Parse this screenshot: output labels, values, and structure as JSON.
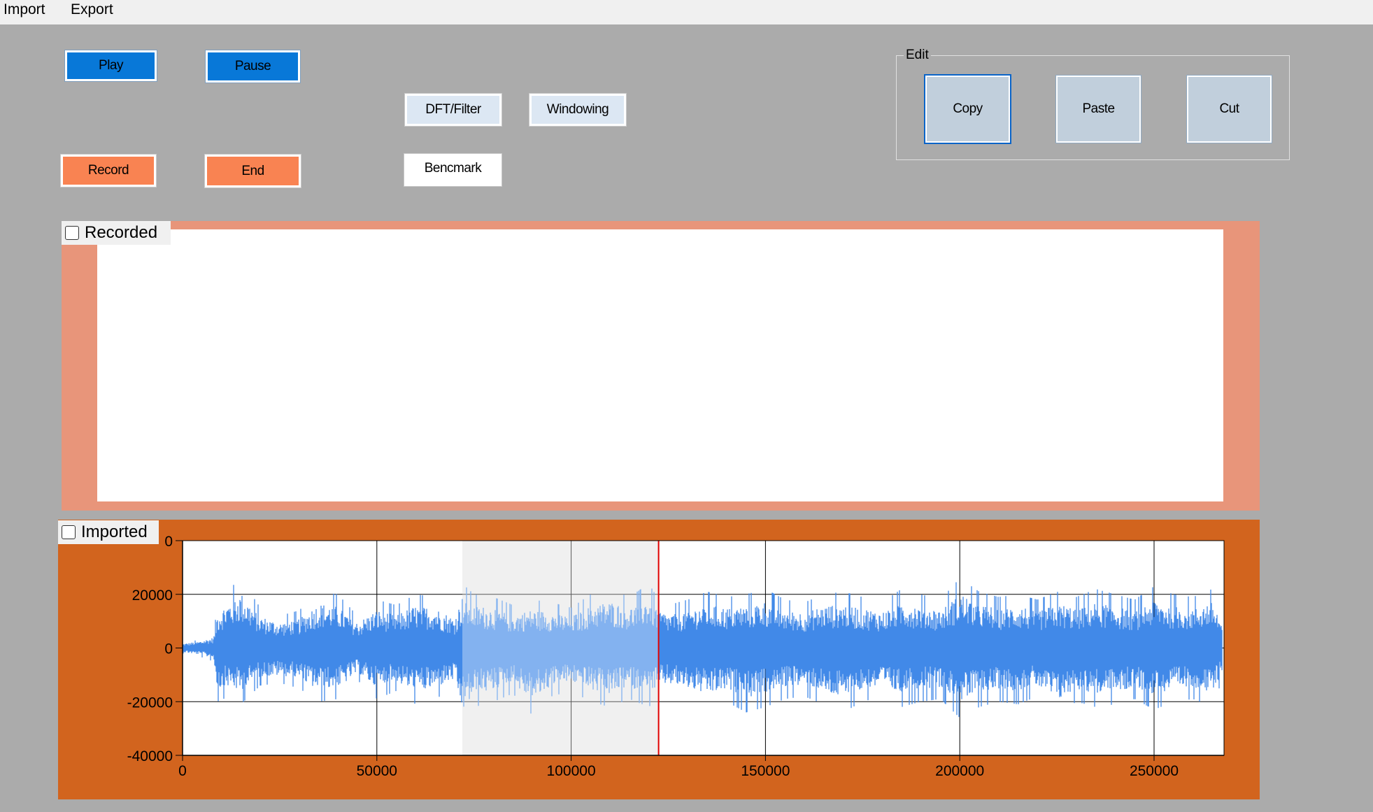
{
  "menu": {
    "import": "Import",
    "export": "Export"
  },
  "transport": {
    "play": "Play",
    "pause": "Pause",
    "record": "Record",
    "end": "End"
  },
  "tools": {
    "dft_filter": "DFT/Filter",
    "windowing": "Windowing",
    "benchmark": "Bencmark"
  },
  "edit_group": {
    "title": "Edit",
    "copy": "Copy",
    "paste": "Paste",
    "cut": "Cut"
  },
  "recorded_panel": {
    "label": "Recorded",
    "checked": false,
    "color": "#e8957a"
  },
  "imported_panel": {
    "label": "Imported",
    "checked": false,
    "color": "#d2641e"
  },
  "colors": {
    "waveform": "#4189e8",
    "selection": "#e8e8e8",
    "cursor": "#e00000"
  },
  "chart_data": {
    "type": "line",
    "title": "",
    "xlabel": "",
    "ylabel": "",
    "xlim": [
      0,
      268000
    ],
    "ylim": [
      -40000,
      40000
    ],
    "x_ticks": [
      0,
      50000,
      100000,
      150000,
      200000,
      250000
    ],
    "x_tick_labels": [
      "0",
      "50000",
      "100000",
      "150000",
      "200000",
      "250000"
    ],
    "y_ticks": [
      40000,
      20000,
      0,
      -20000,
      -40000
    ],
    "y_tick_labels": [
      "0",
      "20000",
      "0",
      "-20000",
      "-40000"
    ],
    "grid": true,
    "selection": [
      72000,
      122500
    ],
    "cursor_x": 122500,
    "series": [
      {
        "envelope_x": [
          0,
          4000,
          8000,
          9000,
          12000,
          15000,
          20000,
          25000,
          30000,
          35000,
          40000,
          45000,
          50000,
          55000,
          60000,
          65000,
          70000,
          72000,
          75000,
          80000,
          85000,
          90000,
          95000,
          100000,
          105000,
          110000,
          115000,
          120000,
          122500,
          125000,
          130000,
          135000,
          140000,
          145000,
          150000,
          155000,
          160000,
          165000,
          170000,
          175000,
          180000,
          185000,
          190000,
          195000,
          200000,
          205000,
          210000,
          215000,
          220000,
          225000,
          230000,
          235000,
          240000,
          245000,
          250000,
          255000,
          260000,
          265000,
          268000
        ],
        "envelope_max": [
          2000,
          3000,
          5000,
          17000,
          22000,
          26000,
          15000,
          12000,
          14000,
          21000,
          20000,
          12000,
          18000,
          16000,
          20000,
          19000,
          14000,
          24000,
          20000,
          19000,
          16000,
          18000,
          17000,
          15000,
          20000,
          22000,
          19000,
          24000,
          18000,
          16000,
          18000,
          21000,
          19000,
          20000,
          22000,
          18000,
          17000,
          20000,
          21000,
          19000,
          17000,
          22000,
          20000,
          18000,
          26000,
          21000,
          19000,
          20000,
          18000,
          21000,
          19000,
          22000,
          20000,
          18000,
          23000,
          20000,
          19000,
          22000,
          10000
        ],
        "envelope_min": [
          -2000,
          -3000,
          -5000,
          -20000,
          -18000,
          -21000,
          -14000,
          -13000,
          -15000,
          -20000,
          -19000,
          -12000,
          -19000,
          -16000,
          -21000,
          -19000,
          -15000,
          -30000,
          -22000,
          -20000,
          -17000,
          -25000,
          -18000,
          -16000,
          -20000,
          -22000,
          -19000,
          -22000,
          -18000,
          -17000,
          -19000,
          -22000,
          -20000,
          -24000,
          -22000,
          -19000,
          -18000,
          -21000,
          -24000,
          -20000,
          -18000,
          -22000,
          -20000,
          -19000,
          -26000,
          -22000,
          -20000,
          -21000,
          -18000,
          -25000,
          -20000,
          -22000,
          -21000,
          -19000,
          -23000,
          -20000,
          -19000,
          -22000,
          -10000
        ]
      }
    ]
  }
}
